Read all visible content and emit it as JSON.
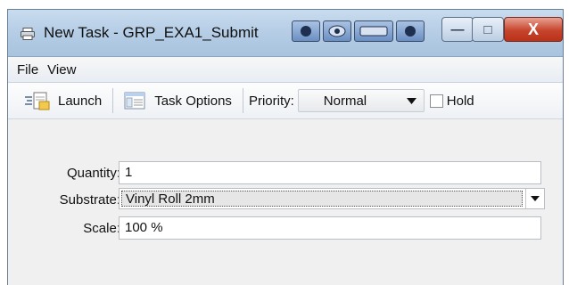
{
  "window": {
    "title": "New Task - GRP_EXA1_Submit",
    "minimize": "—",
    "maximize": "□",
    "close": "X"
  },
  "menu": [
    {
      "label": "File"
    },
    {
      "label": "View"
    }
  ],
  "toolbar": {
    "launch_label": "Launch",
    "task_options_label": "Task Options",
    "priority_label": "Priority:",
    "priority_value": "Normal",
    "hold_label": "Hold",
    "hold_checked": false
  },
  "form": {
    "quantity_label": "Quantity:",
    "quantity_value": "1",
    "substrate_label": "Substrate:",
    "substrate_value": "Vinyl Roll 2mm",
    "scale_label": "Scale:",
    "scale_value": "100 %"
  },
  "icons": {
    "title": "printer-icon",
    "launch": "launch-icon",
    "task_options": "task-options-icon"
  },
  "colors": {
    "titlebar": "#b6cee6",
    "close_button": "#c7442c",
    "window_bg": "#f0f0f0"
  }
}
